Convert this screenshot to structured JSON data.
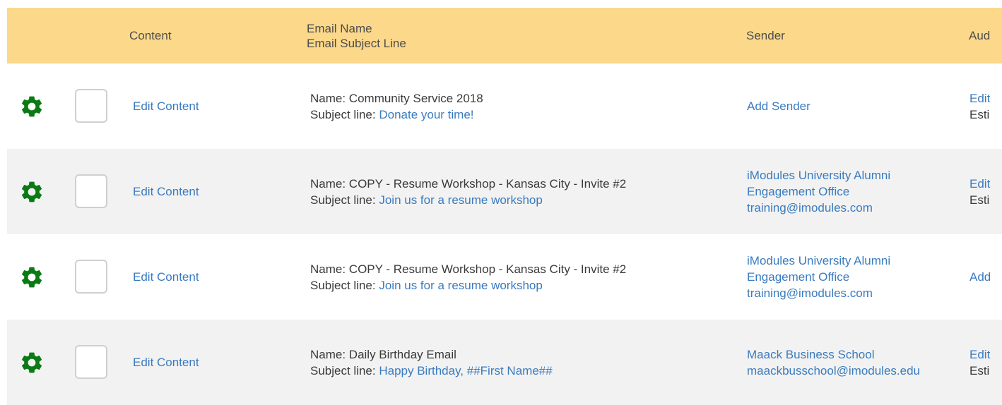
{
  "header": {
    "content": "Content",
    "email_name": "Email Name",
    "email_subject": "Email Subject Line",
    "sender": "Sender",
    "audience": "Aud"
  },
  "colors": {
    "header_bg": "#fbd88a",
    "link": "#3a7bbf",
    "gear": "#0b7a14",
    "row_alt": "#f2f2f2"
  },
  "rows": [
    {
      "gear_icon": "gear-icon",
      "edit_content": "Edit Content",
      "name_prefix": "Name: ",
      "name": "Community Service 2018",
      "subject_prefix": "Subject line: ",
      "subject": "Donate your time!",
      "sender_link": "Add Sender",
      "audience_line1": "Edit",
      "audience_line2": "Esti"
    },
    {
      "gear_icon": "gear-icon",
      "edit_content": "Edit Content",
      "name_prefix": "Name: ",
      "name": "COPY - Resume Workshop - Kansas City - Invite #2",
      "subject_prefix": "Subject line: ",
      "subject": "Join us for a resume workshop",
      "sender_line1": "iModules University Alumni",
      "sender_line2": "Engagement Office",
      "sender_line3": "training@imodules.com",
      "audience_line1": "Edit",
      "audience_line2": "Esti"
    },
    {
      "gear_icon": "gear-icon",
      "edit_content": "Edit Content",
      "name_prefix": "Name: ",
      "name": "COPY - Resume Workshop - Kansas City - Invite #2",
      "subject_prefix": "Subject line: ",
      "subject": "Join us for a resume workshop",
      "sender_line1": "iModules University Alumni",
      "sender_line2": "Engagement Office",
      "sender_line3": "training@imodules.com",
      "audience_line1": "Add"
    },
    {
      "gear_icon": "gear-icon",
      "edit_content": "Edit Content",
      "name_prefix": "Name: ",
      "name": "Daily Birthday Email",
      "subject_prefix": "Subject line: ",
      "subject": "Happy Birthday, ##First Name##",
      "sender_line1": "Maack Business School",
      "sender_line2": "maackbusschool@imodules.edu",
      "audience_line1": "Edit",
      "audience_line2": "Esti"
    }
  ]
}
